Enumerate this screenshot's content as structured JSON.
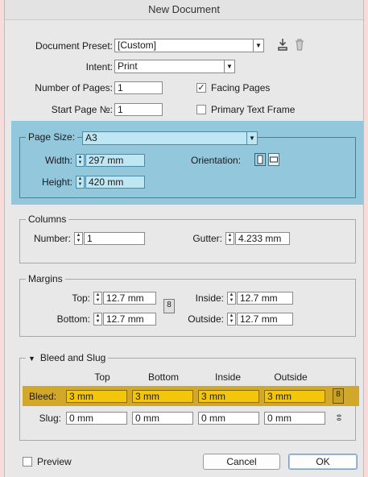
{
  "window": {
    "title": "New Document"
  },
  "document_preset": {
    "label": "Document Preset:",
    "value": "[Custom]"
  },
  "intent": {
    "label": "Intent:",
    "value": "Print"
  },
  "number_of_pages": {
    "label": "Number of Pages:",
    "value": "1"
  },
  "start_page": {
    "label": "Start Page №:",
    "value": "1"
  },
  "facing_pages": {
    "label": "Facing Pages",
    "checked": true
  },
  "primary_text_frame": {
    "label": "Primary Text Frame",
    "checked": false
  },
  "page_size": {
    "label": "Page Size:",
    "value": "A3",
    "width_label": "Width:",
    "width": "297 mm",
    "height_label": "Height:",
    "height": "420 mm",
    "orientation_label": "Orientation:"
  },
  "columns": {
    "title": "Columns",
    "number_label": "Number:",
    "number": "1",
    "gutter_label": "Gutter:",
    "gutter": "4.233 mm"
  },
  "margins": {
    "title": "Margins",
    "top_label": "Top:",
    "top": "12.7 mm",
    "bottom_label": "Bottom:",
    "bottom": "12.7 mm",
    "inside_label": "Inside:",
    "inside": "12.7 mm",
    "outside_label": "Outside:",
    "outside": "12.7 mm"
  },
  "bleed_slug": {
    "title": "Bleed and Slug",
    "headers": [
      "Top",
      "Bottom",
      "Inside",
      "Outside"
    ],
    "bleed_label": "Bleed:",
    "bleed": [
      "3 mm",
      "3 mm",
      "3 mm",
      "3 mm"
    ],
    "slug_label": "Slug:",
    "slug": [
      "0 mm",
      "0 mm",
      "0 mm",
      "0 mm"
    ]
  },
  "preview": {
    "label": "Preview",
    "checked": false
  },
  "buttons": {
    "cancel": "Cancel",
    "ok": "OK"
  },
  "colors": {
    "highlight_blue": "#93c7dc",
    "highlight_gold": "#d1a82a",
    "field_gold": "#f4c60a"
  }
}
